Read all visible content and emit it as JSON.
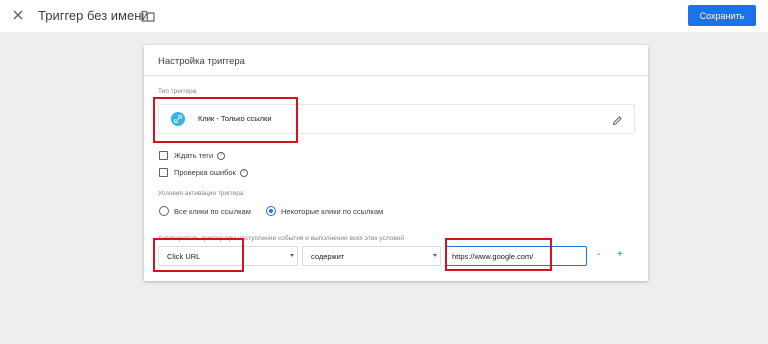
{
  "header": {
    "close_icon": "close-icon",
    "title": "Триггер без имени",
    "folder_icon": "folder-icon",
    "save_label": "Сохранить",
    "accent": "#1a73e8"
  },
  "card": {
    "title": "Настройка триггера",
    "trigger_type": {
      "label": "Тип триггера",
      "name": "Клик - Только ссылки",
      "icon": "link-icon",
      "icon_color": "#33b5e5",
      "edit_icon": "pencil-icon"
    },
    "checkboxes": [
      {
        "label": "Ждать теги",
        "checked": false,
        "help_icon": "help-icon"
      },
      {
        "label": "Проверка ошибок",
        "checked": false,
        "help_icon": "help-icon"
      }
    ],
    "activation": {
      "label": "Условия активации триггера",
      "options": [
        {
          "label": "Все клики по ссылкам",
          "selected": false
        },
        {
          "label": "Некоторые клики по ссылкам",
          "selected": true
        }
      ]
    },
    "condition": {
      "label": "Активировать триггер при наступлении события и выполнении всех этих условий",
      "variable": "Click URL",
      "operator": "содержит",
      "value": "https://www.google.com/",
      "remove_label": "-",
      "add_label": "+"
    }
  },
  "highlight_color": "#d5131e"
}
